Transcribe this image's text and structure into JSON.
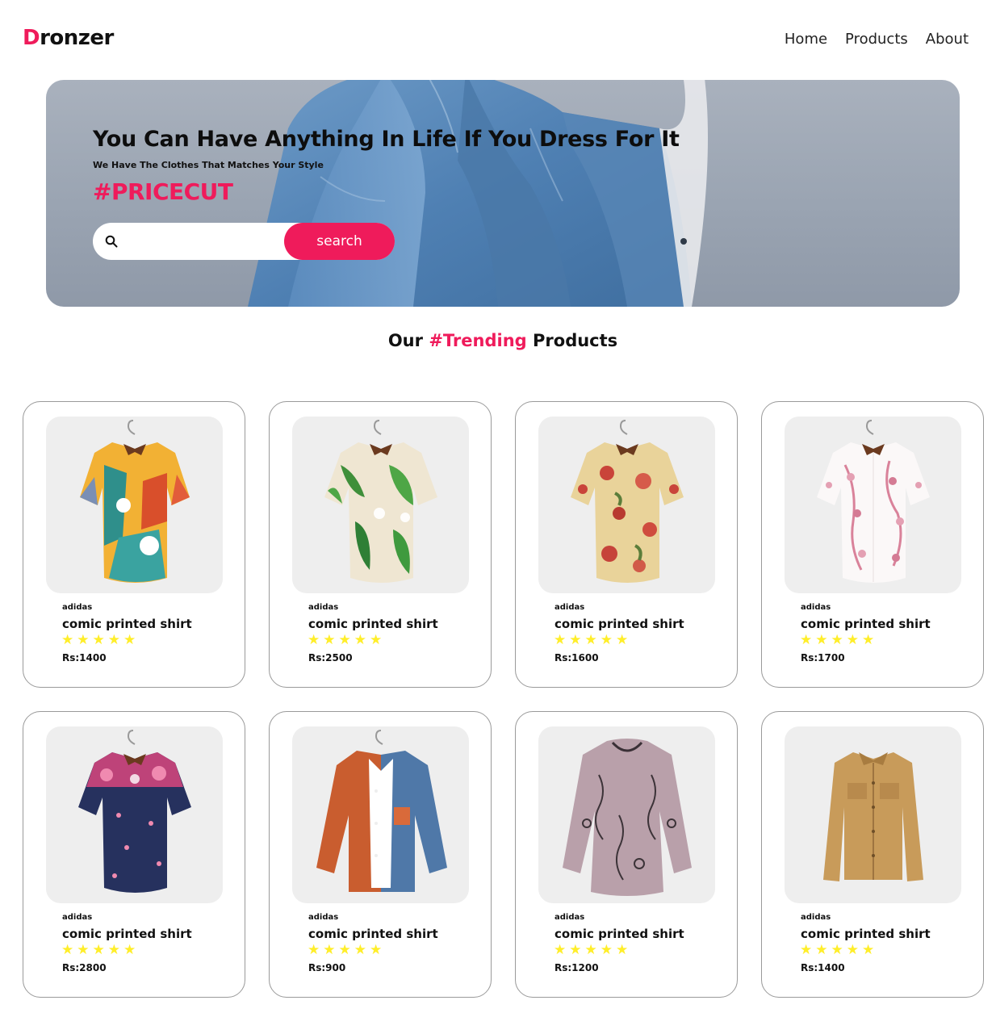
{
  "brand": {
    "initial": "D",
    "rest": "ronzer"
  },
  "nav": {
    "items": [
      "Home",
      "Products",
      "About"
    ]
  },
  "hero": {
    "title": "You Can Have Anything In Life If You Dress For It",
    "subtitle": "We Have The Clothes That Matches Your Style",
    "tag": "#PRICECUT",
    "search_placeholder": "",
    "search_button": "search"
  },
  "section": {
    "prefix": "Our",
    "accent": "#Trending",
    "suffix": "Products"
  },
  "products": [
    {
      "brand": "adidas",
      "name": "comic printed shirt",
      "rating": 5,
      "price": "Rs:1400",
      "art": "abstract-shirt"
    },
    {
      "brand": "adidas",
      "name": "comic printed shirt",
      "rating": 5,
      "price": "Rs:2500",
      "art": "tropical-leaf-shirt"
    },
    {
      "brand": "adidas",
      "name": "comic printed shirt",
      "rating": 5,
      "price": "Rs:1600",
      "art": "floral-shirt"
    },
    {
      "brand": "adidas",
      "name": "comic printed shirt",
      "rating": 5,
      "price": "Rs:1700",
      "art": "white-blossom-shirt"
    },
    {
      "brand": "adidas",
      "name": "comic printed shirt",
      "rating": 5,
      "price": "Rs:2800",
      "art": "navy-floral-shirt"
    },
    {
      "brand": "adidas",
      "name": "comic printed shirt",
      "rating": 5,
      "price": "Rs:900",
      "art": "colorblock-shirt"
    },
    {
      "brand": "adidas",
      "name": "comic printed shirt",
      "rating": 5,
      "price": "Rs:1200",
      "art": "mauve-print-top"
    },
    {
      "brand": "adidas",
      "name": "comic printed shirt",
      "rating": 5,
      "price": "Rs:1400",
      "art": "tan-overshirt"
    }
  ],
  "colors": {
    "accent": "#ef1b5b",
    "star": "#ffee2a",
    "card_border": "#9a9a9a"
  }
}
